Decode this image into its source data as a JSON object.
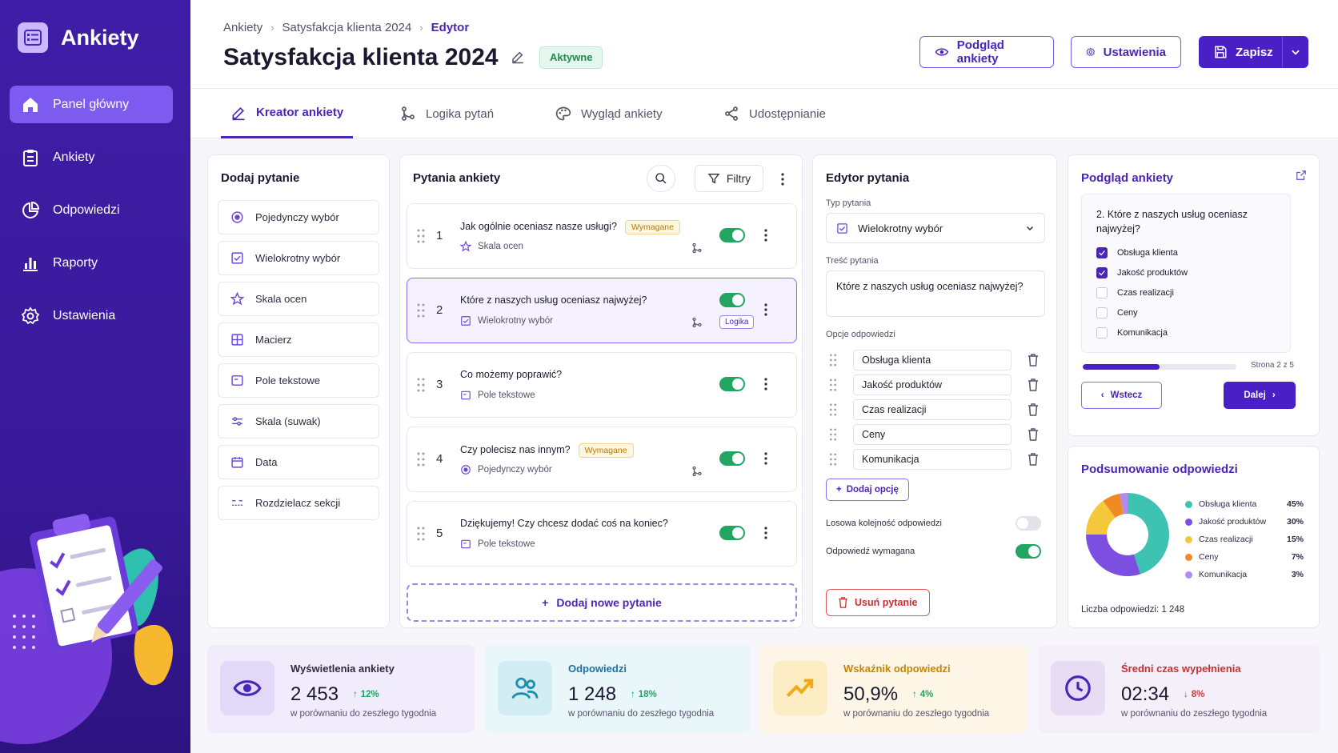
{
  "app": {
    "title": "Ankiety"
  },
  "sidebar": {
    "items": [
      {
        "label": "Panel główny",
        "icon": "home-icon",
        "active": true
      },
      {
        "label": "Ankiety",
        "icon": "clipboard-icon",
        "active": false
      },
      {
        "label": "Odpowiedzi",
        "icon": "pie-chart-icon",
        "active": false
      },
      {
        "label": "Raporty",
        "icon": "bar-chart-icon",
        "active": false
      },
      {
        "label": "Ustawienia",
        "icon": "gear-icon",
        "active": false
      }
    ]
  },
  "header": {
    "breadcrumb": [
      "Ankiety",
      "Satysfakcja klienta 2024",
      "Edytor"
    ],
    "title": "Satysfakcja klienta 2024",
    "status": "Aktywne",
    "preview_label": "Podgląd ankiety",
    "settings_label": "Ustawienia",
    "save_label": "Zapisz"
  },
  "tabs": [
    {
      "label": "Kreator ankiety",
      "icon": "pencil-icon",
      "active": true
    },
    {
      "label": "Logika pytań",
      "icon": "branch-icon",
      "active": false
    },
    {
      "label": "Wygląd ankiety",
      "icon": "palette-icon",
      "active": false
    },
    {
      "label": "Udostępnianie",
      "icon": "share-icon",
      "active": false
    }
  ],
  "add_question": {
    "title": "Dodaj pytanie",
    "types": [
      {
        "label": "Pojedynczy wybór",
        "icon": "radio-icon"
      },
      {
        "label": "Wielokrotny wybór",
        "icon": "checkbox-icon"
      },
      {
        "label": "Skala ocen",
        "icon": "star-icon"
      },
      {
        "label": "Macierz",
        "icon": "grid-icon"
      },
      {
        "label": "Pole tekstowe",
        "icon": "textbox-icon"
      },
      {
        "label": "Skala (suwak)",
        "icon": "slider-icon"
      },
      {
        "label": "Data",
        "icon": "calendar-icon"
      },
      {
        "label": "Rozdzielacz sekcji",
        "icon": "divider-icon"
      }
    ]
  },
  "questions": {
    "title": "Pytania ankiety",
    "filter_label": "Filtry",
    "add_label": "Dodaj nowe pytanie",
    "items": [
      {
        "num": "1",
        "text": "Jak ogólnie oceniasz nasze usługi?",
        "required": "Wymagane",
        "type": "Skala ocen",
        "icon": "star-icon",
        "enabled": true,
        "has_logic": true,
        "logic_badge": ""
      },
      {
        "num": "2",
        "text": "Które z naszych usług oceniasz najwyżej?",
        "required": "",
        "type": "Wielokrotny wybór",
        "icon": "checkbox-icon",
        "enabled": true,
        "has_logic": true,
        "logic_badge": "Logika",
        "selected": true
      },
      {
        "num": "3",
        "text": "Co możemy poprawić?",
        "required": "",
        "type": "Pole tekstowe",
        "icon": "textbox-icon",
        "enabled": true,
        "has_logic": false,
        "logic_badge": ""
      },
      {
        "num": "4",
        "text": "Czy polecisz nas innym?",
        "required": "Wymagane",
        "type": "Pojedynczy wybór",
        "icon": "radio-icon",
        "enabled": true,
        "has_logic": true,
        "logic_badge": ""
      },
      {
        "num": "5",
        "text": "Dziękujemy! Czy chcesz dodać coś na koniec?",
        "required": "",
        "type": "Pole tekstowe",
        "icon": "textbox-icon",
        "enabled": true,
        "has_logic": false,
        "logic_badge": ""
      }
    ]
  },
  "editor": {
    "title": "Edytor pytania",
    "type_label": "Typ pytania",
    "type_value": "Wielokrotny wybór",
    "content_label": "Treść pytania",
    "content_value": "Które z naszych usług oceniasz najwyżej?",
    "options_label": "Opcje odpowiedzi",
    "options": [
      "Obsługa klienta",
      "Jakość produktów",
      "Czas realizacji",
      "Ceny",
      "Komunikacja"
    ],
    "add_option_label": "Dodaj opcję",
    "random_label": "Losowa kolejność odpowiedzi",
    "random_on": false,
    "required_label": "Odpowiedź wymagana",
    "required_on": true,
    "delete_label": "Usuń pytanie"
  },
  "preview": {
    "title": "Podgląd ankiety",
    "question": "2. Które z naszych usług oceniasz najwyżej?",
    "options": [
      {
        "label": "Obsługa klienta",
        "checked": true
      },
      {
        "label": "Jakość produktów",
        "checked": true
      },
      {
        "label": "Czas realizacji",
        "checked": false
      },
      {
        "label": "Ceny",
        "checked": false
      },
      {
        "label": "Komunikacja",
        "checked": false
      }
    ],
    "progress": 0.5,
    "page_indicator": "Strona 2 z 5",
    "back_label": "Wstecz",
    "next_label": "Dalej"
  },
  "summary": {
    "title": "Podsumowanie odpowiedzi",
    "count_label": "Liczba odpowiedzi: 1 248",
    "chart_data": {
      "type": "pie",
      "categories": [
        "Obsługa klienta",
        "Jakość produktów",
        "Czas realizacji",
        "Ceny",
        "Komunikacja"
      ],
      "values": [
        45,
        30,
        15,
        7,
        3
      ],
      "labels": [
        "45%",
        "30%",
        "15%",
        "7%",
        "3%"
      ],
      "colors": [
        "#3ec3b3",
        "#7c4fe0",
        "#f5c73a",
        "#f08a24",
        "#b58af0"
      ]
    }
  },
  "stats": [
    {
      "label": "Wyświetlenia ankiety",
      "value": "2 453",
      "delta": "12%",
      "direction": "up",
      "note": "w porównaniu do zeszłego tygodnia",
      "icon": "eye-icon",
      "bg": "#f1ecfc",
      "iconbg": "#e2d8f8",
      "accent": "#4a26b8"
    },
    {
      "label": "Odpowiedzi",
      "value": "1 248",
      "delta": "18%",
      "direction": "up",
      "note": "w porównaniu do zeszłego tygodnia",
      "icon": "users-icon",
      "bg": "#e9f6fa",
      "iconbg": "#d2edf3",
      "accent": "#1d6fa8"
    },
    {
      "label": "Wskaźnik odpowiedzi",
      "value": "50,9%",
      "delta": "4%",
      "direction": "up",
      "note": "w porównaniu do zeszłego tygodnia",
      "icon": "trend-icon",
      "bg": "#fdf6e6",
      "iconbg": "#fbecc4",
      "accent": "#c78500"
    },
    {
      "label": "Średni czas wypełnienia",
      "value": "02:34",
      "delta": "8%",
      "direction": "down",
      "note": "w porównaniu do zeszłego tygodnia",
      "icon": "clock-icon",
      "bg": "#f4eff9",
      "iconbg": "#e7dcf3",
      "accent": "#c82f2f"
    }
  ]
}
